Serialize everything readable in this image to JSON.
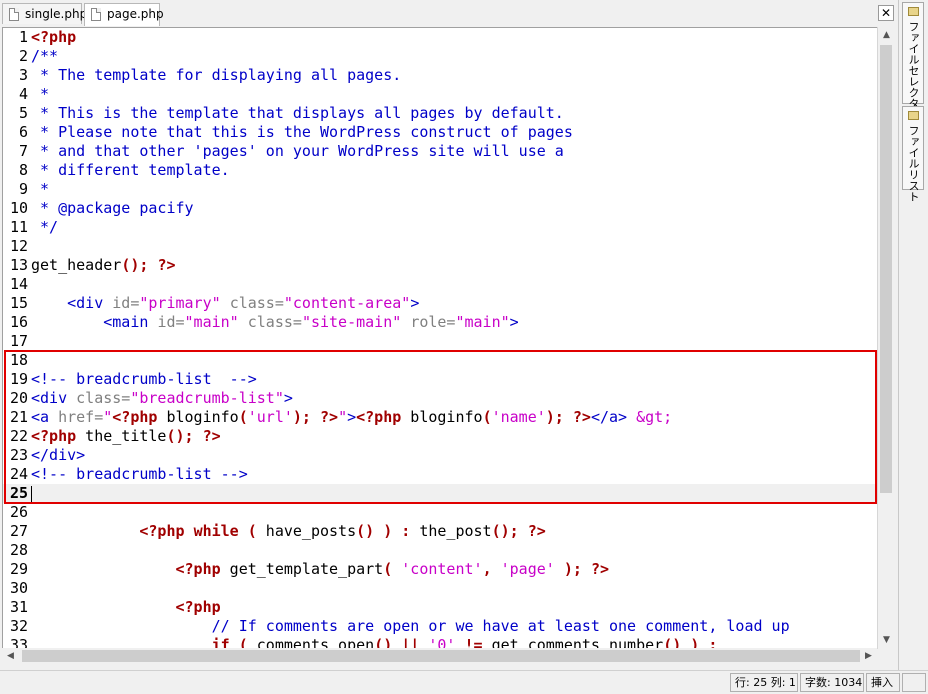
{
  "tabs": [
    {
      "label": "single.php",
      "active": false
    },
    {
      "label": "page.php",
      "active": true
    }
  ],
  "close_glyph": "✕",
  "side_tabs": [
    {
      "label": "ファイルセレクター"
    },
    {
      "label": "ファイルリスト"
    }
  ],
  "status": {
    "position": "行: 25 列: 1",
    "chars": "字数: 1034",
    "mode": "挿入"
  },
  "colors": {
    "php_tag": "#a00000",
    "comment": "#0000c8",
    "string": "#c800c8",
    "highlight_box": "#e00000"
  },
  "editor": {
    "current_line": 25,
    "lines": [
      {
        "n": "1",
        "s": [
          [
            "t-tag",
            "<?php"
          ]
        ]
      },
      {
        "n": "2",
        "s": [
          [
            "t-cm",
            "/**"
          ]
        ]
      },
      {
        "n": "3",
        "s": [
          [
            "t-cm",
            " * The template for displaying all pages."
          ]
        ]
      },
      {
        "n": "4",
        "s": [
          [
            "t-cm",
            " *"
          ]
        ]
      },
      {
        "n": "5",
        "s": [
          [
            "t-cm",
            " * This is the template that displays all pages by default."
          ]
        ]
      },
      {
        "n": "6",
        "s": [
          [
            "t-cm",
            " * Please note that this is the WordPress construct of pages"
          ]
        ]
      },
      {
        "n": "7",
        "s": [
          [
            "t-cm",
            " * and that other 'pages' on your WordPress site will use a"
          ]
        ]
      },
      {
        "n": "8",
        "s": [
          [
            "t-cm",
            " * different template."
          ]
        ]
      },
      {
        "n": "9",
        "s": [
          [
            "t-cm",
            " *"
          ]
        ]
      },
      {
        "n": "10",
        "s": [
          [
            "t-cm",
            " * @package pacify"
          ]
        ]
      },
      {
        "n": "11",
        "s": [
          [
            "t-cm",
            " */"
          ]
        ]
      },
      {
        "n": "12",
        "s": []
      },
      {
        "n": "13",
        "s": [
          [
            "t-pl",
            "get_header"
          ],
          [
            "t-br",
            "();"
          ],
          [
            "t-pl",
            " "
          ],
          [
            "t-tag",
            "?>"
          ]
        ]
      },
      {
        "n": "14",
        "s": []
      },
      {
        "n": "15",
        "s": [
          [
            "t-pl",
            "    "
          ],
          [
            "t-h",
            "<div"
          ],
          [
            "t-pl",
            " "
          ],
          [
            "t-at",
            "id="
          ],
          [
            "t-st",
            "\"primary\""
          ],
          [
            "t-pl",
            " "
          ],
          [
            "t-at",
            "class="
          ],
          [
            "t-st",
            "\"content-area\""
          ],
          [
            "t-h",
            ">"
          ]
        ]
      },
      {
        "n": "16",
        "s": [
          [
            "t-pl",
            "        "
          ],
          [
            "t-h",
            "<main"
          ],
          [
            "t-pl",
            " "
          ],
          [
            "t-at",
            "id="
          ],
          [
            "t-st",
            "\"main\""
          ],
          [
            "t-pl",
            " "
          ],
          [
            "t-at",
            "class="
          ],
          [
            "t-st",
            "\"site-main\""
          ],
          [
            "t-pl",
            " "
          ],
          [
            "t-at",
            "role="
          ],
          [
            "t-st",
            "\"main\""
          ],
          [
            "t-h",
            ">"
          ]
        ]
      },
      {
        "n": "17",
        "s": []
      },
      {
        "n": "18",
        "s": []
      },
      {
        "n": "19",
        "s": [
          [
            "t-cm",
            "<!-- breadcrumb-list  -->"
          ]
        ]
      },
      {
        "n": "20",
        "s": [
          [
            "t-h",
            "<div"
          ],
          [
            "t-pl",
            " "
          ],
          [
            "t-at",
            "class="
          ],
          [
            "t-st",
            "\"breadcrumb-list\""
          ],
          [
            "t-h",
            ">"
          ]
        ]
      },
      {
        "n": "21",
        "s": [
          [
            "t-h",
            "<a"
          ],
          [
            "t-pl",
            " "
          ],
          [
            "t-at",
            "href="
          ],
          [
            "t-st",
            "\""
          ],
          [
            "t-tag",
            "<?php"
          ],
          [
            "t-pl",
            " bloginfo"
          ],
          [
            "t-br",
            "("
          ],
          [
            "t-st",
            "'url'"
          ],
          [
            "t-br",
            ");"
          ],
          [
            "t-pl",
            " "
          ],
          [
            "t-tag",
            "?>"
          ],
          [
            "t-st",
            "\""
          ],
          [
            "t-h",
            ">"
          ],
          [
            "t-tag",
            "<?php"
          ],
          [
            "t-pl",
            " bloginfo"
          ],
          [
            "t-br",
            "("
          ],
          [
            "t-st",
            "'name'"
          ],
          [
            "t-br",
            ");"
          ],
          [
            "t-pl",
            " "
          ],
          [
            "t-tag",
            "?>"
          ],
          [
            "t-h",
            "</a>"
          ],
          [
            "t-pl",
            " "
          ],
          [
            "t-st",
            "&gt;"
          ]
        ]
      },
      {
        "n": "22",
        "s": [
          [
            "t-tag",
            "<?php"
          ],
          [
            "t-pl",
            " the_title"
          ],
          [
            "t-br",
            "();"
          ],
          [
            "t-pl",
            " "
          ],
          [
            "t-tag",
            "?>"
          ]
        ]
      },
      {
        "n": "23",
        "s": [
          [
            "t-h",
            "</div>"
          ]
        ]
      },
      {
        "n": "24",
        "s": [
          [
            "t-cm",
            "<!-- breadcrumb-list -->"
          ]
        ]
      },
      {
        "n": "25",
        "s": []
      },
      {
        "n": "26",
        "s": []
      },
      {
        "n": "27",
        "s": [
          [
            "t-pl",
            "            "
          ],
          [
            "t-tag",
            "<?php"
          ],
          [
            "t-pl",
            " "
          ],
          [
            "t-kw",
            "while"
          ],
          [
            "t-pl",
            " "
          ],
          [
            "t-br",
            "("
          ],
          [
            "t-pl",
            " have_posts"
          ],
          [
            "t-br",
            "()"
          ],
          [
            "t-pl",
            " "
          ],
          [
            "t-br",
            ")"
          ],
          [
            "t-pl",
            " "
          ],
          [
            "t-br",
            ":"
          ],
          [
            "t-pl",
            " the_post"
          ],
          [
            "t-br",
            "();"
          ],
          [
            "t-pl",
            " "
          ],
          [
            "t-tag",
            "?>"
          ]
        ]
      },
      {
        "n": "28",
        "s": []
      },
      {
        "n": "29",
        "s": [
          [
            "t-pl",
            "                "
          ],
          [
            "t-tag",
            "<?php"
          ],
          [
            "t-pl",
            " get_template_part"
          ],
          [
            "t-br",
            "("
          ],
          [
            "t-pl",
            " "
          ],
          [
            "t-st",
            "'content'"
          ],
          [
            "t-br",
            ","
          ],
          [
            "t-pl",
            " "
          ],
          [
            "t-st",
            "'page'"
          ],
          [
            "t-pl",
            " "
          ],
          [
            "t-br",
            ");"
          ],
          [
            "t-pl",
            " "
          ],
          [
            "t-tag",
            "?>"
          ]
        ]
      },
      {
        "n": "30",
        "s": []
      },
      {
        "n": "31",
        "s": [
          [
            "t-pl",
            "                "
          ],
          [
            "t-tag",
            "<?php"
          ]
        ]
      },
      {
        "n": "32",
        "s": [
          [
            "t-pl",
            "                    "
          ],
          [
            "t-cm",
            "// If comments are open or we have at least one comment, load up"
          ]
        ]
      },
      {
        "n": "33",
        "s": [
          [
            "t-pl",
            "                    "
          ],
          [
            "t-kw",
            "if"
          ],
          [
            "t-pl",
            " "
          ],
          [
            "t-br",
            "("
          ],
          [
            "t-pl",
            " comments_open"
          ],
          [
            "t-br",
            "()"
          ],
          [
            "t-pl",
            " "
          ],
          [
            "t-br",
            "||"
          ],
          [
            "t-pl",
            " "
          ],
          [
            "t-st",
            "'0'"
          ],
          [
            "t-pl",
            " "
          ],
          [
            "t-br",
            "!="
          ],
          [
            "t-pl",
            " get_comments_number"
          ],
          [
            "t-br",
            "()"
          ],
          [
            "t-pl",
            " "
          ],
          [
            "t-br",
            ")"
          ],
          [
            "t-pl",
            " "
          ],
          [
            "t-br",
            ":"
          ]
        ]
      }
    ]
  }
}
